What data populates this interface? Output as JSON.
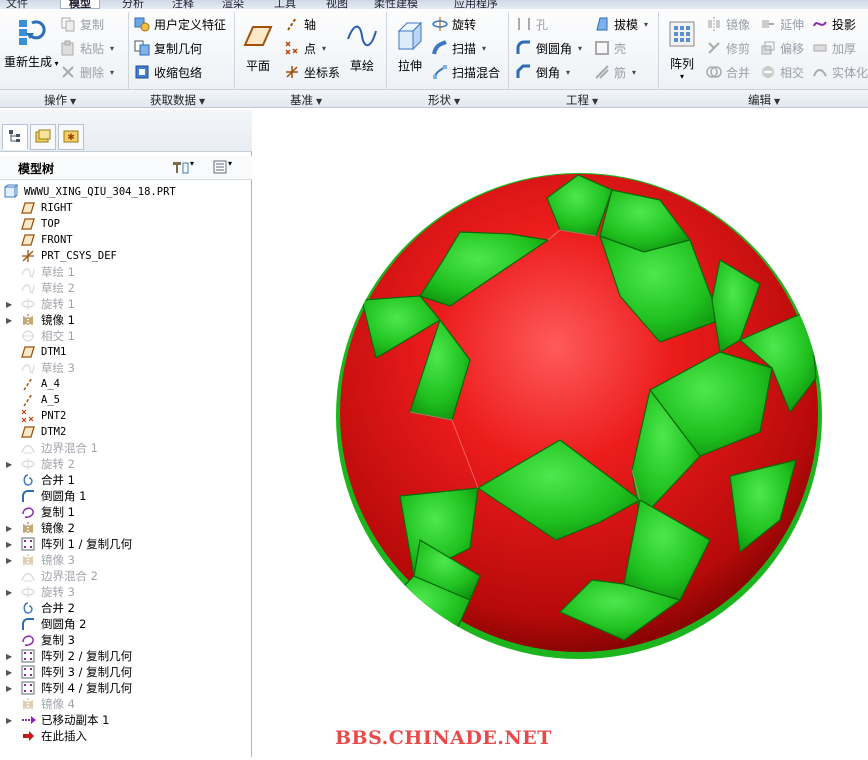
{
  "ribbon": {
    "tabs": [
      "文件",
      "模型",
      "分析",
      "注释",
      "渲染",
      "工具",
      "柔性建模",
      "视图",
      "应用程序"
    ],
    "active_tab": "模型",
    "groups": [
      {
        "name": "操作",
        "items": [
          "重新生成",
          "复制",
          "粘贴",
          "删除"
        ]
      },
      {
        "name": "获取数据",
        "items": [
          "用户定义特征",
          "复制几何",
          "收缩包络"
        ]
      },
      {
        "name": "基准",
        "items": [
          "平面",
          "轴",
          "点",
          "坐标系",
          "草绘"
        ]
      },
      {
        "name": "形状",
        "items": [
          "拉伸",
          "旋转",
          "扫描",
          "扫描混合"
        ]
      },
      {
        "name": "工程",
        "items": [
          "孔",
          "拔模",
          "倒圆角",
          "壳",
          "倒角",
          "筋"
        ]
      },
      {
        "name": "编辑",
        "items": [
          "阵列",
          "镜像",
          "延伸",
          "投影",
          "修剪",
          "偏移",
          "加厚",
          "合并",
          "相交",
          "实体化"
        ]
      }
    ]
  },
  "model_tree": {
    "title": "模型树",
    "root": "WWWU_XING_QIU_304_18.PRT",
    "items": [
      {
        "label": "RIGHT",
        "icon": "datum-plane-icon",
        "disabled": false,
        "expandable": false,
        "mono": true
      },
      {
        "label": "TOP",
        "icon": "datum-plane-icon",
        "disabled": false,
        "expandable": false,
        "mono": true
      },
      {
        "label": "FRONT",
        "icon": "datum-plane-icon",
        "disabled": false,
        "expandable": false,
        "mono": true
      },
      {
        "label": "PRT_CSYS_DEF",
        "icon": "csys-icon",
        "disabled": false,
        "expandable": false,
        "mono": true
      },
      {
        "label": "草绘 1",
        "icon": "sketch-icon",
        "disabled": true,
        "expandable": false,
        "mono": false
      },
      {
        "label": "草绘 2",
        "icon": "sketch-icon",
        "disabled": true,
        "expandable": false,
        "mono": false
      },
      {
        "label": "旋转 1",
        "icon": "revolve-icon",
        "disabled": true,
        "expandable": true,
        "mono": false
      },
      {
        "label": "镜像 1",
        "icon": "mirror-icon",
        "disabled": false,
        "expandable": true,
        "mono": false
      },
      {
        "label": "相交 1",
        "icon": "intersect-icon",
        "disabled": true,
        "expandable": false,
        "mono": false
      },
      {
        "label": "DTM1",
        "icon": "datum-plane-icon",
        "disabled": false,
        "expandable": false,
        "mono": true
      },
      {
        "label": "草绘 3",
        "icon": "sketch-icon",
        "disabled": true,
        "expandable": false,
        "mono": false
      },
      {
        "label": "A_4",
        "icon": "axis-icon",
        "disabled": false,
        "expandable": false,
        "mono": true
      },
      {
        "label": "A_5",
        "icon": "axis-icon",
        "disabled": false,
        "expandable": false,
        "mono": true
      },
      {
        "label": "PNT2",
        "icon": "point-icon",
        "disabled": false,
        "expandable": false,
        "mono": true
      },
      {
        "label": "DTM2",
        "icon": "datum-plane-icon",
        "disabled": false,
        "expandable": false,
        "mono": true
      },
      {
        "label": "边界混合 1",
        "icon": "boundary-blend-icon",
        "disabled": true,
        "expandable": false,
        "mono": false
      },
      {
        "label": "旋转 2",
        "icon": "revolve-icon",
        "disabled": true,
        "expandable": true,
        "mono": false
      },
      {
        "label": "合并 1",
        "icon": "merge-icon",
        "disabled": false,
        "expandable": false,
        "mono": false
      },
      {
        "label": "倒圆角 1",
        "icon": "round-icon",
        "disabled": false,
        "expandable": false,
        "mono": false
      },
      {
        "label": "复制 1",
        "icon": "copy-icon",
        "disabled": false,
        "expandable": false,
        "mono": false
      },
      {
        "label": "镜像 2",
        "icon": "mirror-icon",
        "disabled": false,
        "expandable": true,
        "mono": false
      },
      {
        "label": "阵列 1 / 复制几何",
        "icon": "pattern-icon",
        "disabled": false,
        "expandable": true,
        "mono": false
      },
      {
        "label": "镜像 3",
        "icon": "mirror-icon",
        "disabled": true,
        "expandable": true,
        "mono": false
      },
      {
        "label": "边界混合 2",
        "icon": "boundary-blend-icon",
        "disabled": true,
        "expandable": false,
        "mono": false
      },
      {
        "label": "旋转 3",
        "icon": "revolve-icon",
        "disabled": true,
        "expandable": true,
        "mono": false
      },
      {
        "label": "合并 2",
        "icon": "merge-icon",
        "disabled": false,
        "expandable": false,
        "mono": false
      },
      {
        "label": "倒圆角 2",
        "icon": "round-icon",
        "disabled": false,
        "expandable": false,
        "mono": false
      },
      {
        "label": "复制 3",
        "icon": "copy-icon",
        "disabled": false,
        "expandable": false,
        "mono": false
      },
      {
        "label": "阵列 2 / 复制几何",
        "icon": "pattern-icon",
        "disabled": false,
        "expandable": true,
        "mono": false
      },
      {
        "label": "阵列 3 / 复制几何",
        "icon": "pattern-icon",
        "disabled": false,
        "expandable": true,
        "mono": false
      },
      {
        "label": "阵列 4 / 复制几何",
        "icon": "pattern-icon",
        "disabled": false,
        "expandable": true,
        "mono": false
      },
      {
        "label": "镜像 4",
        "icon": "mirror-icon",
        "disabled": true,
        "expandable": false,
        "mono": false
      },
      {
        "label": "已移动副本 1",
        "icon": "moved-copy-icon",
        "disabled": false,
        "expandable": true,
        "mono": false
      },
      {
        "label": "在此插入",
        "icon": "insert-here-icon",
        "disabled": false,
        "expandable": false,
        "mono": false
      }
    ]
  },
  "viewport": {
    "ball_colors": {
      "base": "#e01414",
      "panels": "#1ec81e"
    }
  },
  "watermark": "BBS.CHINADE.NET"
}
